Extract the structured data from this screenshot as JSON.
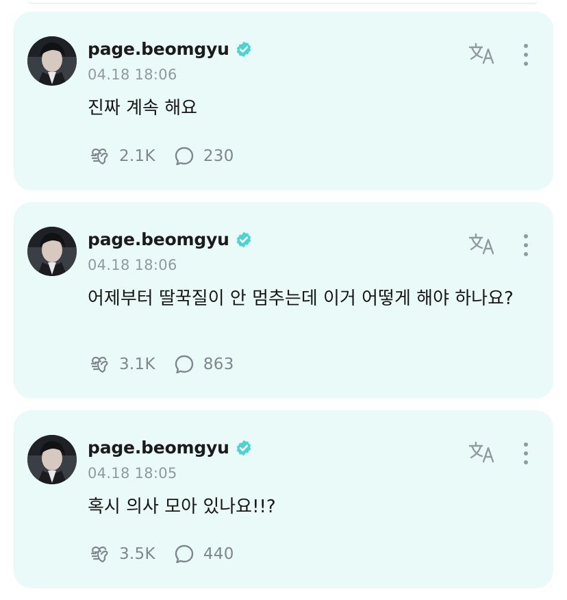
{
  "colors": {
    "card_background": "#e9faf8",
    "verified_badge": "#4fd3d0",
    "muted_text": "#8f9aa0"
  },
  "posts": [
    {
      "username": "page.beomgyu",
      "timestamp": "04.18 18:06",
      "text": "진짜 계속 해요",
      "likes": "2.1K",
      "comments": "230"
    },
    {
      "username": "page.beomgyu",
      "timestamp": "04.18 18:06",
      "text": "어제부터 딸꾹질이 안 멈추는데 이거 어떻게 해야 하나요?",
      "likes": "3.1K",
      "comments": "863"
    },
    {
      "username": "page.beomgyu",
      "timestamp": "04.18 18:05",
      "text": "혹시 의사 모아 있나요!!?",
      "likes": "3.5K",
      "comments": "440"
    }
  ],
  "icons": {
    "like": "heart-icon",
    "comment": "comment-bubble-icon",
    "translate": "translate-icon",
    "more": "more-vertical-icon",
    "verified": "verified-badge-icon"
  }
}
